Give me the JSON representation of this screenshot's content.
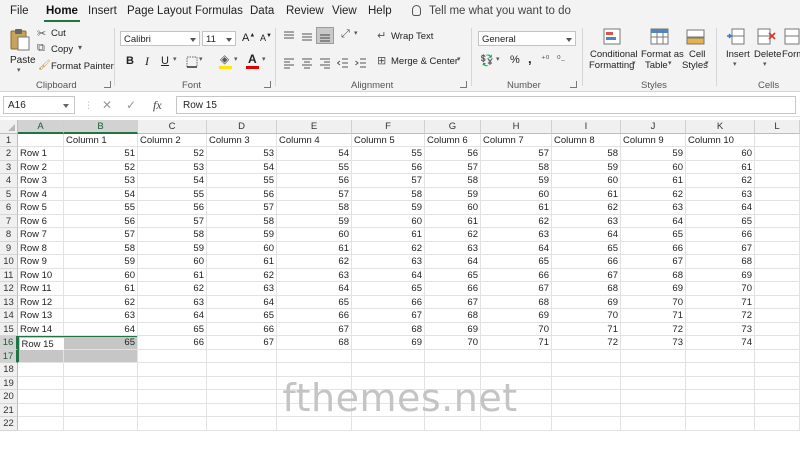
{
  "menu": {
    "tabs": [
      "File",
      "Home",
      "Insert",
      "Page Layout",
      "Formulas",
      "Data",
      "Review",
      "View",
      "Help"
    ],
    "active": "Home",
    "tell_me": "Tell me what you want to do"
  },
  "ribbon": {
    "clipboard": {
      "paste": "Paste",
      "cut": "Cut",
      "copy": "Copy",
      "format_painter": "Format Painter",
      "label": "Clipboard"
    },
    "font": {
      "name": "Calibri",
      "size": "11",
      "bold": "B",
      "italic": "I",
      "underline": "U",
      "font_color_letter": "A",
      "label": "Font"
    },
    "alignment": {
      "wrap_text": "Wrap Text",
      "merge_center": "Merge & Center",
      "label": "Alignment"
    },
    "number": {
      "format": "General",
      "percent": "%",
      "comma": ",",
      "label": "Number"
    },
    "styles": {
      "conditional": "Conditional",
      "formatting": "Formatting",
      "format_as": "Format as",
      "table": "Table",
      "cell": "Cell",
      "cell_styles": "Styles",
      "label": "Styles"
    },
    "cells": {
      "insert": "Insert",
      "delete": "Delete",
      "format": "Form",
      "label": "Cells"
    }
  },
  "formula_bar": {
    "name_box": "A16",
    "cancel": "✕",
    "enter": "✓",
    "fx": "fx",
    "content": "Row 15"
  },
  "grid": {
    "columns": [
      "A",
      "B",
      "C",
      "D",
      "E",
      "F",
      "G",
      "H",
      "I",
      "J",
      "K",
      "L"
    ],
    "rows": [
      "1",
      "2",
      "3",
      "4",
      "5",
      "6",
      "7",
      "8",
      "9",
      "10",
      "11",
      "12",
      "13",
      "14",
      "15",
      "16",
      "17",
      "18",
      "19",
      "20",
      "21",
      "22"
    ],
    "header_row": [
      "",
      "Column 1",
      "Column 2",
      "Column 3",
      "Column 4",
      "Column 5",
      "Column 6",
      "Column 7",
      "Column 8",
      "Column 9",
      "Column 10",
      ""
    ],
    "row_labels": [
      "Row 1",
      "Row 2",
      "Row 3",
      "Row 4",
      "Row 5",
      "Row 6",
      "Row 7",
      "Row 8",
      "Row 9",
      "Row 10",
      "Row 11",
      "Row 12",
      "Row 13",
      "Row 14",
      "Row 15"
    ],
    "values": [
      [
        51,
        52,
        53,
        54,
        55,
        56,
        57,
        58,
        59,
        60
      ],
      [
        52,
        53,
        54,
        55,
        56,
        57,
        58,
        59,
        60,
        61
      ],
      [
        53,
        54,
        55,
        56,
        57,
        58,
        59,
        60,
        61,
        62
      ],
      [
        54,
        55,
        56,
        57,
        58,
        59,
        60,
        61,
        62,
        63
      ],
      [
        55,
        56,
        57,
        58,
        59,
        60,
        61,
        62,
        63,
        64
      ],
      [
        56,
        57,
        58,
        59,
        60,
        61,
        62,
        63,
        64,
        65
      ],
      [
        57,
        58,
        59,
        60,
        61,
        62,
        63,
        64,
        65,
        66
      ],
      [
        58,
        59,
        60,
        61,
        62,
        63,
        64,
        65,
        66,
        67
      ],
      [
        59,
        60,
        61,
        62,
        63,
        64,
        65,
        66,
        67,
        68
      ],
      [
        60,
        61,
        62,
        63,
        64,
        65,
        66,
        67,
        68,
        69
      ],
      [
        61,
        62,
        63,
        64,
        65,
        66,
        67,
        68,
        69,
        70
      ],
      [
        62,
        63,
        64,
        65,
        66,
        67,
        68,
        69,
        70,
        71
      ],
      [
        63,
        64,
        65,
        66,
        67,
        68,
        69,
        70,
        71,
        72
      ],
      [
        64,
        65,
        66,
        67,
        68,
        69,
        70,
        71,
        72,
        73
      ],
      [
        65,
        66,
        67,
        68,
        69,
        70,
        71,
        72,
        73,
        74
      ]
    ],
    "selection": {
      "top_row": "16",
      "bottom_row": "17",
      "left_col": "A",
      "right_col": "B"
    }
  },
  "watermark": "fthemes.net",
  "colors": {
    "excel_green": "#217346",
    "font_color_bar": "#e00000",
    "fill_color_bar": "#ffe500"
  }
}
